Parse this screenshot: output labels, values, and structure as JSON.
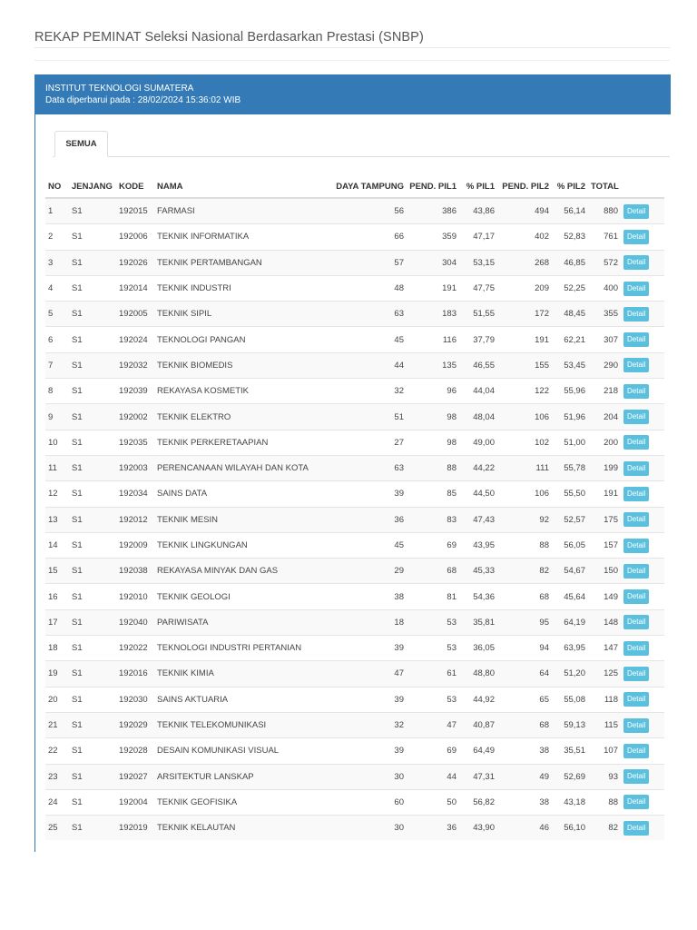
{
  "page": {
    "title": "REKAP PEMINAT Seleksi Nasional Berdasarkan Prestasi (SNBP)"
  },
  "panel": {
    "institution": "INSTITUT TEKNOLOGI SUMATERA",
    "updated": "Data diperbarui pada : 28/02/2024 15:36:02 WIB"
  },
  "tabs": [
    {
      "label": "SEMUA"
    }
  ],
  "table": {
    "headers": [
      "NO",
      "JENJANG",
      "KODE",
      "NAMA",
      "DAYA TAMPUNG",
      "PEND. PIL1",
      "% PIL1",
      "PEND. PIL2",
      "% PIL2",
      "TOTAL",
      ""
    ],
    "button_label": "Detail",
    "rows": [
      [
        "1",
        "S1",
        "192015",
        "FARMASI",
        "56",
        "386",
        "43,86",
        "494",
        "56,14",
        "880"
      ],
      [
        "2",
        "S1",
        "192006",
        "TEKNIK INFORMATIKA",
        "66",
        "359",
        "47,17",
        "402",
        "52,83",
        "761"
      ],
      [
        "3",
        "S1",
        "192026",
        "TEKNIK PERTAMBANGAN",
        "57",
        "304",
        "53,15",
        "268",
        "46,85",
        "572"
      ],
      [
        "4",
        "S1",
        "192014",
        "TEKNIK INDUSTRI",
        "48",
        "191",
        "47,75",
        "209",
        "52,25",
        "400"
      ],
      [
        "5",
        "S1",
        "192005",
        "TEKNIK SIPIL",
        "63",
        "183",
        "51,55",
        "172",
        "48,45",
        "355"
      ],
      [
        "6",
        "S1",
        "192024",
        "TEKNOLOGI PANGAN",
        "45",
        "116",
        "37,79",
        "191",
        "62,21",
        "307"
      ],
      [
        "7",
        "S1",
        "192032",
        "TEKNIK BIOMEDIS",
        "44",
        "135",
        "46,55",
        "155",
        "53,45",
        "290"
      ],
      [
        "8",
        "S1",
        "192039",
        "REKAYASA KOSMETIK",
        "32",
        "96",
        "44,04",
        "122",
        "55,96",
        "218"
      ],
      [
        "9",
        "S1",
        "192002",
        "TEKNIK ELEKTRO",
        "51",
        "98",
        "48,04",
        "106",
        "51,96",
        "204"
      ],
      [
        "10",
        "S1",
        "192035",
        "TEKNIK PERKERETAAPIAN",
        "27",
        "98",
        "49,00",
        "102",
        "51,00",
        "200"
      ],
      [
        "11",
        "S1",
        "192003",
        "PERENCANAAN WILAYAH DAN KOTA",
        "63",
        "88",
        "44,22",
        "111",
        "55,78",
        "199"
      ],
      [
        "12",
        "S1",
        "192034",
        "SAINS DATA",
        "39",
        "85",
        "44,50",
        "106",
        "55,50",
        "191"
      ],
      [
        "13",
        "S1",
        "192012",
        "TEKNIK MESIN",
        "36",
        "83",
        "47,43",
        "92",
        "52,57",
        "175"
      ],
      [
        "14",
        "S1",
        "192009",
        "TEKNIK LINGKUNGAN",
        "45",
        "69",
        "43,95",
        "88",
        "56,05",
        "157"
      ],
      [
        "15",
        "S1",
        "192038",
        "REKAYASA MINYAK DAN GAS",
        "29",
        "68",
        "45,33",
        "82",
        "54,67",
        "150"
      ],
      [
        "16",
        "S1",
        "192010",
        "TEKNIK GEOLOGI",
        "38",
        "81",
        "54,36",
        "68",
        "45,64",
        "149"
      ],
      [
        "17",
        "S1",
        "192040",
        "PARIWISATA",
        "18",
        "53",
        "35,81",
        "95",
        "64,19",
        "148"
      ],
      [
        "18",
        "S1",
        "192022",
        "TEKNOLOGI INDUSTRI PERTANIAN",
        "39",
        "53",
        "36,05",
        "94",
        "63,95",
        "147"
      ],
      [
        "19",
        "S1",
        "192016",
        "TEKNIK KIMIA",
        "47",
        "61",
        "48,80",
        "64",
        "51,20",
        "125"
      ],
      [
        "20",
        "S1",
        "192030",
        "SAINS AKTUARIA",
        "39",
        "53",
        "44,92",
        "65",
        "55,08",
        "118"
      ],
      [
        "21",
        "S1",
        "192029",
        "TEKNIK TELEKOMUNIKASI",
        "32",
        "47",
        "40,87",
        "68",
        "59,13",
        "115"
      ],
      [
        "22",
        "S1",
        "192028",
        "DESAIN KOMUNIKASI VISUAL",
        "39",
        "69",
        "64,49",
        "38",
        "35,51",
        "107"
      ],
      [
        "23",
        "S1",
        "192027",
        "ARSITEKTUR LANSKAP",
        "30",
        "44",
        "47,31",
        "49",
        "52,69",
        "93"
      ],
      [
        "24",
        "S1",
        "192004",
        "TEKNIK GEOFISIKA",
        "60",
        "50",
        "56,82",
        "38",
        "43,18",
        "88"
      ],
      [
        "25",
        "S1",
        "192019",
        "TEKNIK KELAUTAN",
        "30",
        "36",
        "43,90",
        "46",
        "56,10",
        "82"
      ]
    ]
  },
  "colors": {
    "panel_header": "#337ab7",
    "detail_button": "#5bc0de"
  }
}
